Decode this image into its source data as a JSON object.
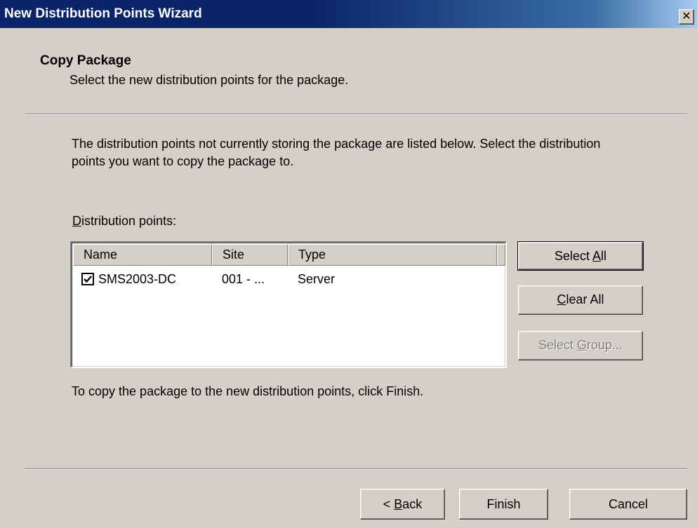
{
  "window": {
    "title": "New Distribution Points Wizard",
    "close_glyph": "✕"
  },
  "header": {
    "title": "Copy Package",
    "subtitle": "Select the new distribution points for the package."
  },
  "intro_text": "The distribution points not currently storing the package are listed below. Select the distribution points you  want to copy the package to.",
  "distribution_points": {
    "label_accel": "D",
    "label_rest": "istribution points:",
    "columns": [
      "Name",
      "Site",
      "Type"
    ],
    "rows": [
      {
        "checked": true,
        "name": "SMS2003-DC",
        "site": "001 - ...",
        "type": "Server"
      }
    ]
  },
  "side_buttons": {
    "select_all": {
      "pre": "Select ",
      "accel": "A",
      "post": "ll"
    },
    "clear_all": {
      "pre": "",
      "accel": "C",
      "post": "lear All"
    },
    "select_group": {
      "pre": "Select ",
      "accel": "G",
      "post": "roup..."
    }
  },
  "finish_note": "To copy the package to the new distribution points, click Finish.",
  "footer_buttons": {
    "back": {
      "pre": "< ",
      "accel": "B",
      "post": "ack"
    },
    "finish": "Finish",
    "cancel": "Cancel"
  },
  "colors": {
    "titlebar": "#0a246a",
    "face": "#d4d0c8",
    "disabled_text": "#808080"
  }
}
